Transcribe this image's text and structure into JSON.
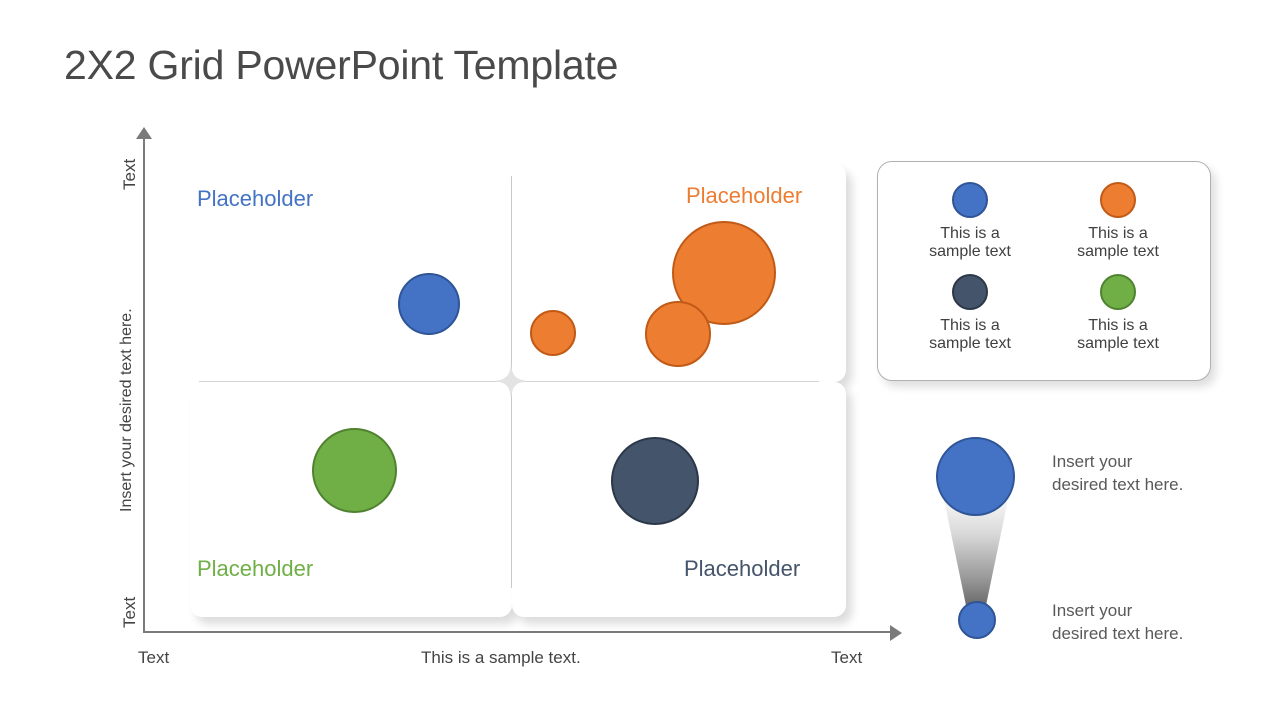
{
  "slide": {
    "title": "2X2 Grid PowerPoint Template"
  },
  "colors": {
    "blue": "#4472C4",
    "orange": "#ED7D31",
    "green": "#6FAF46",
    "navy": "#44546A",
    "title_text": "#4a4a4a",
    "body_text": "#595959",
    "axis": "#7a7a7a"
  },
  "axes": {
    "y": {
      "top_label": "Text",
      "middle_label": "Insert your desired text here.",
      "bottom_label": "Text"
    },
    "x": {
      "left_label": "Text",
      "center_label": "This is a sample text.",
      "right_label": "Text"
    }
  },
  "quadrants": [
    {
      "id": "top-left",
      "label": "Placeholder",
      "color": "#4472C4"
    },
    {
      "id": "top-right",
      "label": "Placeholder",
      "color": "#ED7D31"
    },
    {
      "id": "bottom-left",
      "label": "Placeholder",
      "color": "#6FAF46"
    },
    {
      "id": "bottom-right",
      "label": "Placeholder",
      "color": "#44546A"
    }
  ],
  "legend": {
    "items": [
      {
        "color": "#4472C4",
        "text": "This is a\nsample text"
      },
      {
        "color": "#ED7D31",
        "text": "This is a\nsample text"
      },
      {
        "color": "#44546A",
        "text": "This is a\nsample text"
      },
      {
        "color": "#6FAF46",
        "text": "This is a\nsample text"
      }
    ]
  },
  "callout": {
    "top_text": "Insert your\ndesired text here.",
    "bottom_text": "Insert your\ndesired text here."
  },
  "chart_data": {
    "type": "scatter",
    "title": "2X2 Grid PowerPoint Template",
    "xlabel": "This is a sample text.",
    "ylabel": "Insert your desired text here.",
    "xlim": [
      0,
      100
    ],
    "ylim": [
      0,
      100
    ],
    "grid": false,
    "legend_position": "right",
    "xtick_labels": [
      "Text",
      "This is a sample text.",
      "Text"
    ],
    "ytick_labels": [
      "Text",
      "Insert your desired text here.",
      "Text"
    ],
    "quadrant_labels": [
      "Placeholder",
      "Placeholder",
      "Placeholder",
      "Placeholder"
    ],
    "series": [
      {
        "name": "This is a sample text",
        "color": "#4472C4",
        "points": [
          {
            "x": 38,
            "y": 72,
            "size": 62
          }
        ]
      },
      {
        "name": "This is a sample text",
        "color": "#ED7D31",
        "points": [
          {
            "x": 55,
            "y": 63,
            "size": 46
          },
          {
            "x": 71,
            "y": 66,
            "size": 66
          },
          {
            "x": 76,
            "y": 82,
            "size": 104
          }
        ]
      },
      {
        "name": "This is a sample text",
        "color": "#6FAF46",
        "points": [
          {
            "x": 26,
            "y": 31,
            "size": 85
          }
        ]
      },
      {
        "name": "This is a sample text",
        "color": "#44546A",
        "points": [
          {
            "x": 66,
            "y": 29,
            "size": 88
          }
        ]
      }
    ]
  }
}
